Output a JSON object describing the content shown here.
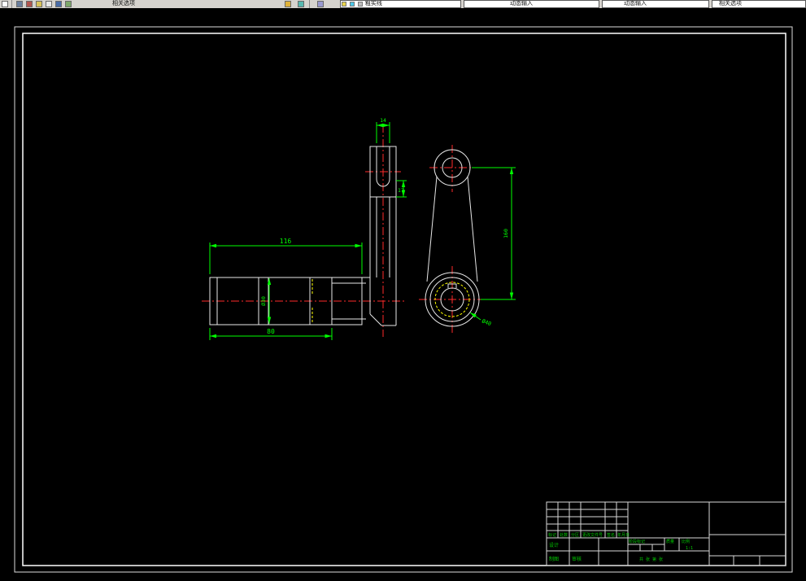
{
  "toolbar": {
    "label": "相关选项",
    "fields": [
      {
        "value": "粗实线"
      },
      {
        "value": "动态输入"
      },
      {
        "value": "动态输入"
      },
      {
        "value": "相关选项"
      }
    ]
  },
  "drawing": {
    "dims": {
      "d116": "116",
      "d80": "80",
      "d14": "14",
      "d17": "17",
      "dia30": "Ø30",
      "d160": "160",
      "dia40": "Ø40"
    },
    "colors": {
      "line": "#e8e8e8",
      "centerline": "#ff2a2a",
      "dimension": "#00ff00",
      "auxiliary": "#ffff00",
      "background": "#000000"
    }
  },
  "title_block": {
    "revision_headers": [
      "标记",
      "处数",
      "分区",
      "更改文件号",
      "签名",
      "年月日"
    ],
    "roles": [
      "设计",
      "制图",
      "审核"
    ],
    "stage_label": "阶段标记",
    "weight_label": "质量",
    "scale_label": "比例",
    "scale_value": "1:1",
    "sheet_text": "共 张 第 张"
  }
}
